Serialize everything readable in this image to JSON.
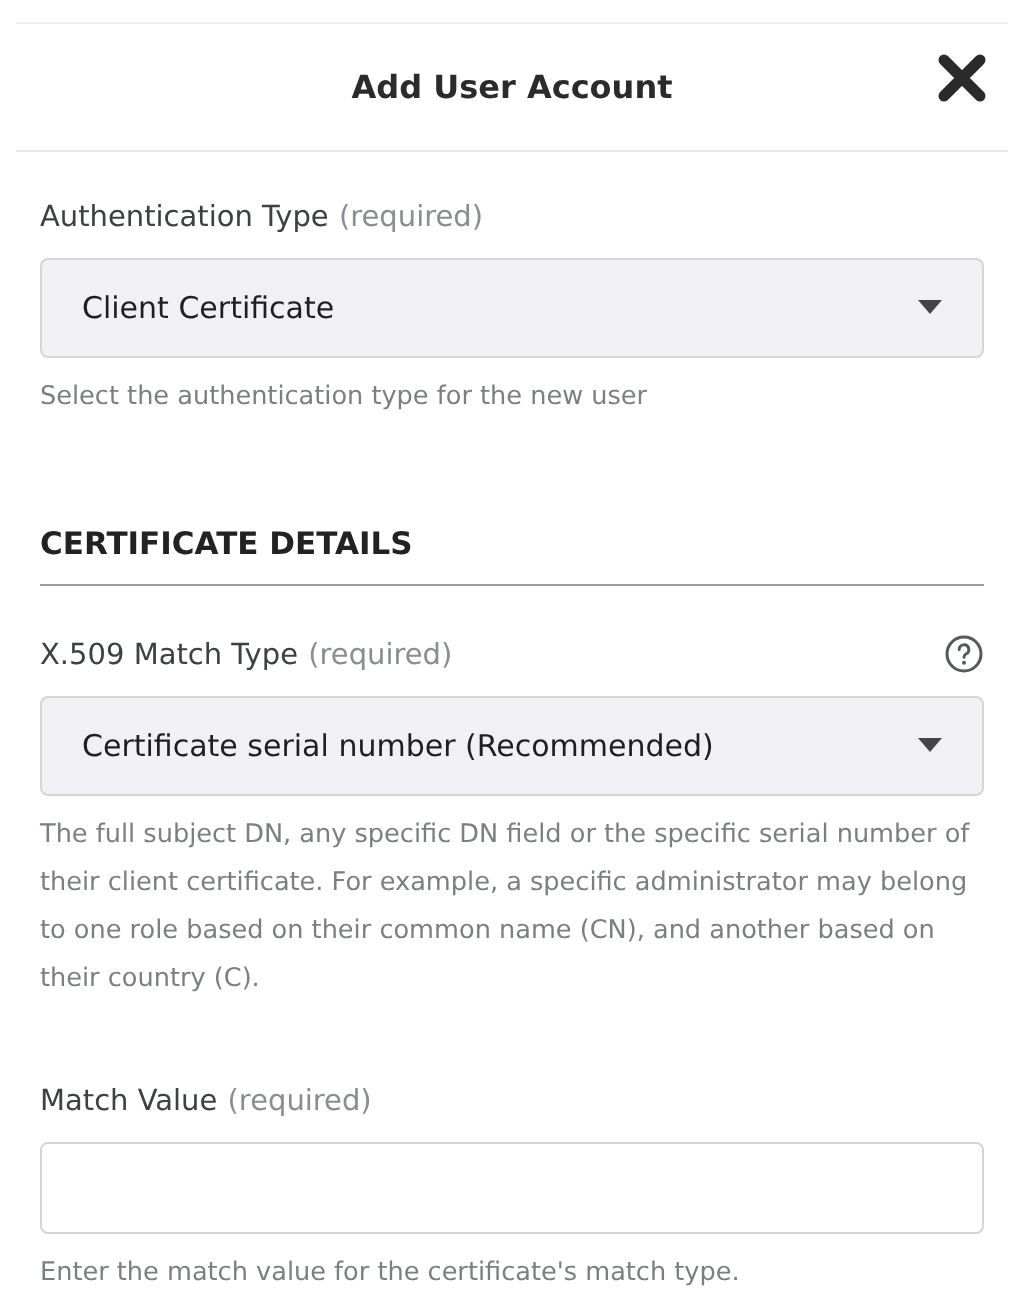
{
  "dialog": {
    "title": "Add User Account"
  },
  "fields": [
    {
      "kind": "select",
      "label": "Authentication Type",
      "qualifier": "(required)",
      "value": "Client Certificate",
      "help": "Select the authentication type for the new user",
      "has_info": false
    },
    {
      "kind": "heading",
      "label": "CERTIFICATE DETAILS"
    },
    {
      "kind": "select",
      "label": "X.509 Match Type",
      "qualifier": "(required)",
      "value": "Certificate serial number (Recommended)",
      "help": "The full subject DN, any specific DN field or the specific serial number of their client certificate. For example, a specific administrator may belong to one role based on their common name (CN), and another based on their country (C).",
      "has_info": true
    },
    {
      "kind": "text",
      "label": "Match Value",
      "qualifier": "(required)",
      "help": "Enter the match value for the certificate's match type.",
      "has_info": false
    }
  ]
}
